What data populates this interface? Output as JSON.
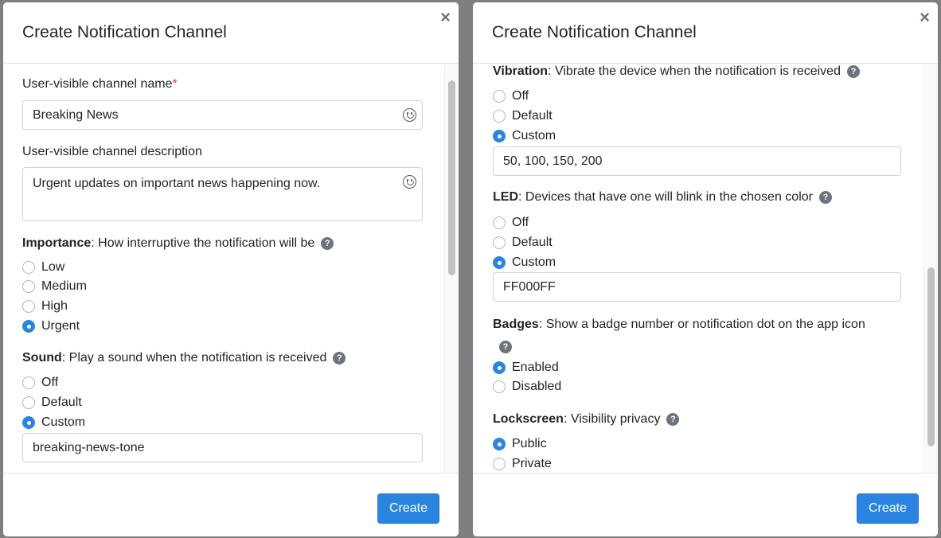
{
  "left_modal": {
    "title": "Create Notification Channel",
    "close_glyph": "×",
    "channel_name_label": "User-visible channel name",
    "required_marker": "*",
    "channel_name_value": "Breaking News",
    "channel_description_label": "User-visible channel description",
    "channel_description_value": "Urgent updates on important news happening now.",
    "importance": {
      "title": "Importance",
      "description": ": How interruptive the notification will be",
      "options": [
        "Low",
        "Medium",
        "High",
        "Urgent"
      ],
      "selected": "Urgent"
    },
    "sound": {
      "title": "Sound",
      "description": ": Play a sound when the notification is received",
      "options": [
        "Off",
        "Default",
        "Custom"
      ],
      "selected": "Custom",
      "custom_value": "breaking-news-tone"
    },
    "create_label": "Create"
  },
  "right_modal": {
    "title": "Create Notification Channel",
    "close_glyph": "×",
    "vibration": {
      "title": "Vibration",
      "description": ": Vibrate the device when the notification is received",
      "options": [
        "Off",
        "Default",
        "Custom"
      ],
      "selected": "Custom",
      "custom_value": "50, 100, 150, 200"
    },
    "led": {
      "title": "LED",
      "description": ": Devices that have one will blink in the chosen color",
      "options": [
        "Off",
        "Default",
        "Custom"
      ],
      "selected": "Custom",
      "custom_value": "FF000FF"
    },
    "badges": {
      "title": "Badges",
      "description": ": Show a badge number or notification dot on the app icon",
      "options": [
        "Enabled",
        "Disabled"
      ],
      "selected": "Enabled"
    },
    "lockscreen": {
      "title": "Lockscreen",
      "description": ": Visibility privacy",
      "options": [
        "Public",
        "Private"
      ],
      "selected": "Public"
    },
    "create_label": "Create"
  },
  "help_glyph": "?",
  "colors": {
    "accent": "#2b84e0",
    "required": "#dc3545",
    "backdrop": "#7d7f82"
  }
}
